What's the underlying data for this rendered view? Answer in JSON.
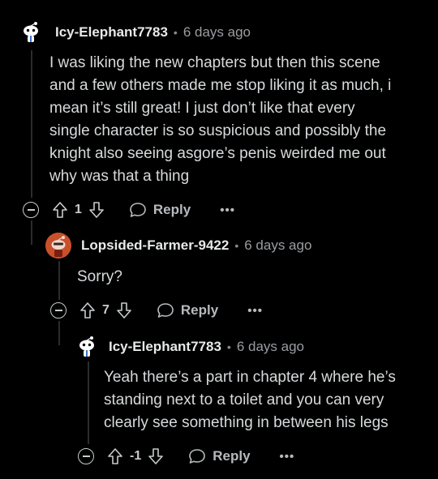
{
  "comments": [
    {
      "username": "Icy-Elephant7783",
      "time": "6 days ago",
      "avatar": "snoo-bw-avatar",
      "lines": [
        "I was liking the new chapters but then this scene",
        "and a few others made me stop liking it as much, i",
        "mean it’s still great! I just don’t like that every",
        "single character is so suspicious and possibly the",
        "knight also seeing asgore’s penis weirded me out",
        "why was that a thing"
      ],
      "votes": "1",
      "reply_label": "Reply",
      "more_label": "•••"
    },
    {
      "username": "Lopsided-Farmer-9422",
      "time": "6 days ago",
      "avatar": "snoo-orange-avatar",
      "lines": [
        "Sorry?"
      ],
      "votes": "7",
      "reply_label": "Reply",
      "more_label": "•••"
    },
    {
      "username": "Icy-Elephant7783",
      "time": "6 days ago",
      "avatar": "snoo-bw-avatar",
      "lines": [
        "Yeah there’s a part in chapter 4 where he’s",
        "standing next to a toilet and you can very",
        "clearly see something in between his legs"
      ],
      "votes": "-1",
      "reply_label": "Reply",
      "more_label": "•••"
    }
  ],
  "colors": {
    "background": "#000000",
    "text": "#d7dadc",
    "thread_line": "#2a2c2e",
    "orange_avatar": "#c9502c"
  }
}
